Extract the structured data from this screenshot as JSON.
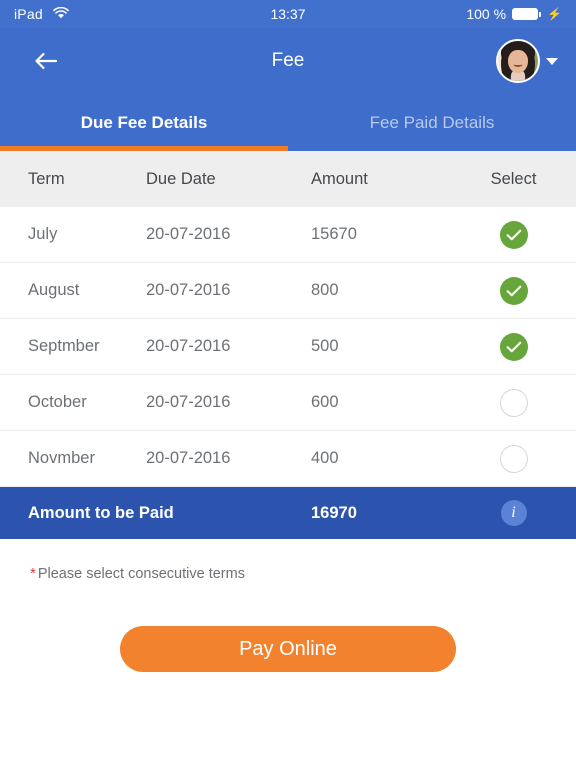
{
  "status_bar": {
    "device": "iPad",
    "wifi_icon": "wifi-icon",
    "time": "13:37",
    "battery_percent": "100 %",
    "charging_icon": "lightning-bolt-icon"
  },
  "header": {
    "back_icon": "back-arrow-icon",
    "title": "Fee",
    "avatar_icon": "user-avatar",
    "dropdown_icon": "chevron-down-icon"
  },
  "tabs": [
    {
      "label": "Due Fee Details",
      "active": true
    },
    {
      "label": "Fee Paid Details",
      "active": false
    }
  ],
  "table": {
    "columns": [
      "Term",
      "Due Date",
      "Amount",
      "Select"
    ],
    "rows": [
      {
        "term": "July",
        "due_date": "20-07-2016",
        "amount": "15670",
        "selected": true
      },
      {
        "term": "August",
        "due_date": "20-07-2016",
        "amount": "800",
        "selected": true
      },
      {
        "term": "Septmber",
        "due_date": "20-07-2016",
        "amount": "500",
        "selected": true
      },
      {
        "term": "October",
        "due_date": "20-07-2016",
        "amount": "600",
        "selected": false
      },
      {
        "term": "Novmber",
        "due_date": "20-07-2016",
        "amount": "400",
        "selected": false
      }
    ]
  },
  "total": {
    "label": "Amount to be Paid",
    "amount": "16970",
    "info_icon": "info-icon"
  },
  "note": {
    "marker": "*",
    "text": "Please select consecutive terms"
  },
  "actions": {
    "pay_label": "Pay Online"
  },
  "colors": {
    "header_blue": "#3e6dcb",
    "status_blue": "#4271cd",
    "total_blue": "#2c54ae",
    "accent_orange": "#f2822e",
    "check_green": "#67a63b",
    "header_row_gray": "#eeeeee",
    "text_gray": "#6d7176",
    "required_red": "#e53935"
  }
}
